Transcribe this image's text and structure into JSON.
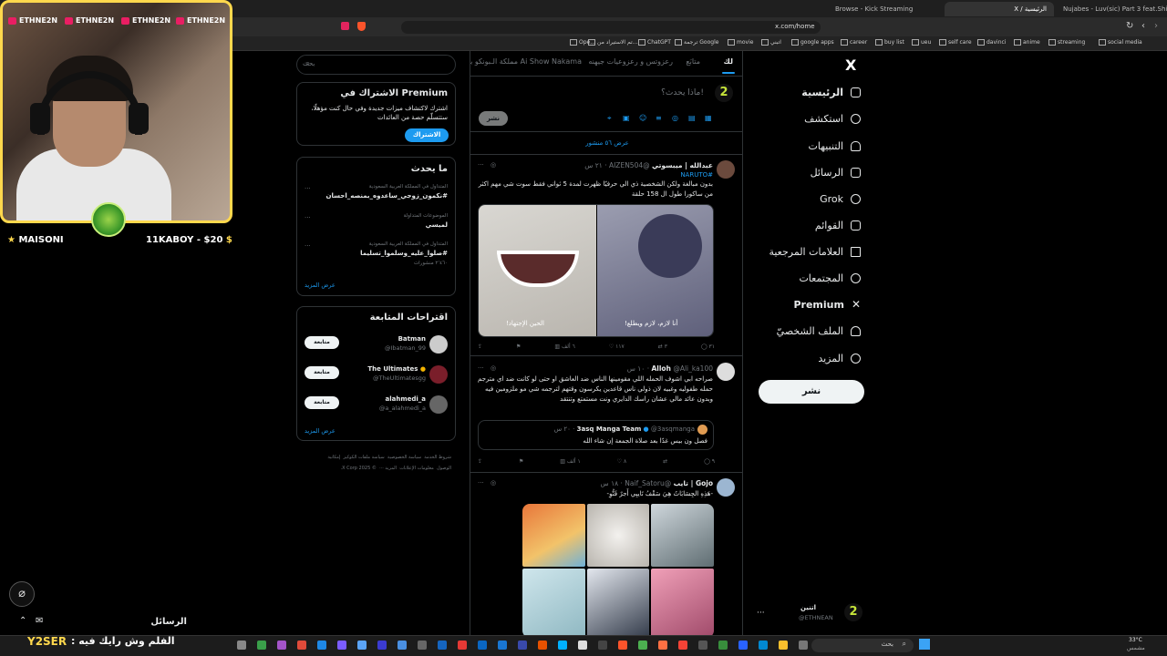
{
  "browser": {
    "tabs": [
      {
        "label": "Browse - Kick Streaming"
      },
      {
        "label": "X / الرئيسية",
        "active": true
      },
      {
        "label": "Nujabes - Luv(sic) Part 3 feat.Shi"
      }
    ],
    "url": "x.com/home",
    "bookmarks": [
      "social media",
      "streaming",
      "anime",
      "davinci",
      "self care",
      "ueu",
      "buy list",
      "career",
      "google apps",
      "اتبني",
      "movie",
      "ترجمة Google",
      "ChatGPT",
      "تم الاستيراد من...",
      "Ope..."
    ]
  },
  "stream": {
    "tags": [
      "ETHNE2N",
      "ETHNE2N",
      "ETHNE2N",
      "ETHNE2N"
    ],
    "left_label": "MAISONI",
    "right_label": "11KABOY - $20",
    "chat_header": "الرسائل",
    "overlay_text": "الفلم وش رايك فيه :",
    "overlay_user": "Y2SER"
  },
  "sidebar": {
    "logo": "X",
    "items": [
      {
        "label": "الرئيسية",
        "icon": "home-icon"
      },
      {
        "label": "استكشف",
        "icon": "search-icon"
      },
      {
        "label": "التنبيهات",
        "icon": "bell-icon"
      },
      {
        "label": "الرسائل",
        "icon": "mail-icon"
      },
      {
        "label": "Grok",
        "icon": "grok-icon"
      },
      {
        "label": "القوائم",
        "icon": "list-icon"
      },
      {
        "label": "العلامات المرجعية",
        "icon": "bookmark-icon"
      },
      {
        "label": "المجتمعات",
        "icon": "communities-icon"
      },
      {
        "label": "Premium",
        "icon": "x-icon"
      },
      {
        "label": "الملف الشخصيّ",
        "icon": "profile-icon"
      },
      {
        "label": "المزيد",
        "icon": "more-icon"
      }
    ],
    "post_button": "نشر",
    "account": {
      "name": "اتنين",
      "handle": "@ETHNEAN",
      "avatar": "2"
    }
  },
  "feed": {
    "tabs": [
      "لك",
      "متابَع",
      "رعزوتس و رعزوعيات جيهنه",
      "Ai Show Nakama",
      "مملكة الـبونكو باسـ"
    ],
    "composer_placeholder": "ماذا يحدث؟!",
    "composer_post": "نشر",
    "show_posts": "عرض ٥٦ منشور",
    "tweets": [
      {
        "name": "عبدالله | ميبسوتي",
        "handle": "@AIZEN504",
        "time": "٢١ س",
        "text": "بدون مبالغة ولكن الشخصية ذي الي حرفيًا ظهرت لمدة 5 ثواني فقط سوت شي مهم اكثر من ساكورا طول ال 158 حلقة",
        "hashtag": "#NARUTO",
        "actions": {
          "replies": "٣١",
          "retweets": "٣",
          "likes": "١١٧",
          "views": "٦ ألف"
        },
        "image_captions": [
          "الحين الإجتهاد!",
          "أنا لازم، لازم ويطلع!"
        ]
      },
      {
        "name": "Alloh",
        "handle": "@Ali_ka100",
        "time": "١٠ س",
        "text": "صراحه ابي اشوف الحمله اللي مقومينها الناس ضد العاشق او حتى لو كانت ضد اي مترجم حمله طفوليه وغبيه لان ذولي ناس قاعدين يكرسون وقتهم لترجمه شي مو ملزومين فيه وبدون عائد مالي عشان راسك الدايري ونت مستمتع وتنتقد",
        "quote": {
          "name": "3asq Manga Team",
          "handle": "@3asqmanga",
          "time": "٢٠ س",
          "text": "فصل ون بيس غدًا بعد صلاة الجمعة إن شاء الله"
        },
        "actions": {
          "replies": "٩",
          "retweets": "",
          "likes": "٨",
          "views": "١ ألف"
        }
      },
      {
        "name": "Gojo | تايب",
        "handle": "@Naif_Satoru",
        "time": "١٨ س",
        "text": "-هَذِهِ الجِسَابَاتُ هِيَ سَقْفُ تَايبِي أَجرٌ فَنُّوِ-"
      }
    ]
  },
  "right": {
    "search_placeholder": "بحث",
    "premium": {
      "title": "الاشتراك في Premium",
      "text": "اشترك لاكتشاف ميزات جديدة وفي حال كنت مؤهلًا، ستتسلّم حصة من العائدات",
      "button": "الاشتراك"
    },
    "trends": {
      "title": "ما يحدث",
      "items": [
        {
          "context": "المتداول في المملكة العربية السعودية",
          "name": "#نكمون_زوجي_ساعدوه_بمنصه_احسان",
          "count": ""
        },
        {
          "context": "الموضوعات المتداولة",
          "name": "لميسي",
          "count": ""
        },
        {
          "context": "المتداول في المملكة العربية السعودية",
          "name": "#صلوا_عليه_وسلموا_تسليما",
          "count": "٢٬٤٦٠ منشورات"
        }
      ],
      "show_more": "عرض المزيد"
    },
    "follow": {
      "title": "اقتراحات المتابعة",
      "items": [
        {
          "name": "Batman",
          "handle": "@Ibatman_99",
          "button": "متابعة"
        },
        {
          "name": "The Ultimates",
          "handle": "@TheUltimatesgg",
          "button": "متابعة"
        },
        {
          "name": "alahmedi_a",
          "handle": "@a_alahmedi_a",
          "button": "متابعة"
        }
      ],
      "show_more": "عرض المزيد"
    },
    "footer": [
      "شروط الخدمة",
      "سياسة الخصوصية",
      "سياسة ملفات الكوكيز",
      "إمكانية الوصول",
      "معلومات الإعلانات",
      "المزيد ···",
      "© 2025 X Corp."
    ]
  },
  "taskbar": {
    "search": "بحث",
    "weather": "33°C",
    "weather_sub": "مشمس"
  }
}
